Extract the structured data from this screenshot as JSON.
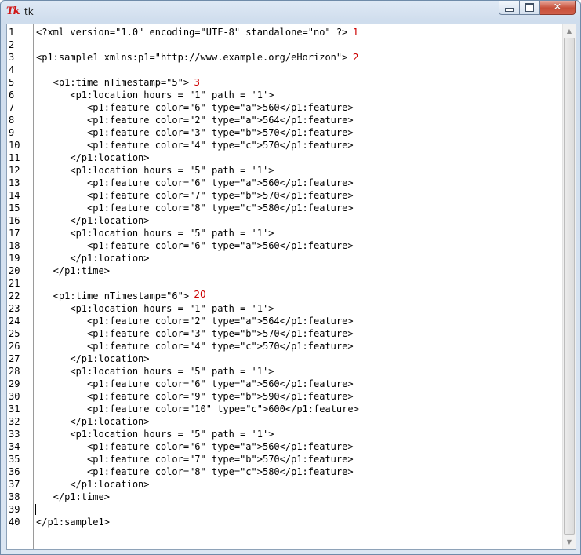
{
  "window": {
    "title": "tk",
    "logo_text": "Tk",
    "buttons": {
      "minimize": "minimize",
      "maximize": "maximize",
      "close": "close"
    }
  },
  "editor": {
    "line_numbers": [
      "1",
      "2",
      "3",
      "4",
      "5",
      "6",
      "7",
      "8",
      "9",
      "10",
      "11",
      "12",
      "13",
      "14",
      "15",
      "16",
      "17",
      "18",
      "19",
      "20",
      "21",
      "22",
      "23",
      "24",
      "25",
      "26",
      "27",
      "28",
      "29",
      "30",
      "31",
      "32",
      "33",
      "34",
      "35",
      "36",
      "37",
      "38",
      "39",
      "40"
    ],
    "lines": [
      "<?xml version=\"1.0\" encoding=\"UTF-8\" standalone=\"no\" ?>",
      "",
      "<p1:sample1 xmlns:p1=\"http://www.example.org/eHorizon\">",
      "",
      "   <p1:time nTimestamp=\"5\">",
      "      <p1:location hours = \"1\" path = '1'>",
      "         <p1:feature color=\"6\" type=\"a\">560</p1:feature>",
      "         <p1:feature color=\"2\" type=\"a\">564</p1:feature>",
      "         <p1:feature color=\"3\" type=\"b\">570</p1:feature>",
      "         <p1:feature color=\"4\" type=\"c\">570</p1:feature>",
      "      </p1:location>",
      "      <p1:location hours = \"5\" path = '1'>",
      "         <p1:feature color=\"6\" type=\"a\">560</p1:feature>",
      "         <p1:feature color=\"7\" type=\"b\">570</p1:feature>",
      "         <p1:feature color=\"8\" type=\"c\">580</p1:feature>",
      "      </p1:location>",
      "      <p1:location hours = \"5\" path = '1'>",
      "         <p1:feature color=\"6\" type=\"a\">560</p1:feature>",
      "      </p1:location>",
      "   </p1:time>",
      "",
      "   <p1:time nTimestamp=\"6\">",
      "      <p1:location hours = \"1\" path = '1'>",
      "         <p1:feature color=\"2\" type=\"a\">564</p1:feature>",
      "         <p1:feature color=\"3\" type=\"b\">570</p1:feature>",
      "         <p1:feature color=\"4\" type=\"c\">570</p1:feature>",
      "      </p1:location>",
      "      <p1:location hours = \"5\" path = '1'>",
      "         <p1:feature color=\"6\" type=\"a\">560</p1:feature>",
      "         <p1:feature color=\"9\" type=\"b\">590</p1:feature>",
      "         <p1:feature color=\"10\" type=\"c\">600</p1:feature>",
      "      </p1:location>",
      "      <p1:location hours = \"5\" path = '1'>",
      "         <p1:feature color=\"6\" type=\"a\">560</p1:feature>",
      "         <p1:feature color=\"7\" type=\"b\">570</p1:feature>",
      "         <p1:feature color=\"8\" type=\"c\">580</p1:feature>",
      "      </p1:location>",
      "   </p1:time>",
      "",
      "</p1:sample1>"
    ],
    "annotations": [
      {
        "text": "1",
        "line": 1
      },
      {
        "text": "2",
        "line": 3
      },
      {
        "text": "3",
        "line": 5
      },
      {
        "text": "20",
        "line": 22
      }
    ],
    "annotation_color": "#cc0000"
  },
  "scrollbar": {
    "up_icon": "arrow-up-icon",
    "down_icon": "arrow-down-icon"
  }
}
